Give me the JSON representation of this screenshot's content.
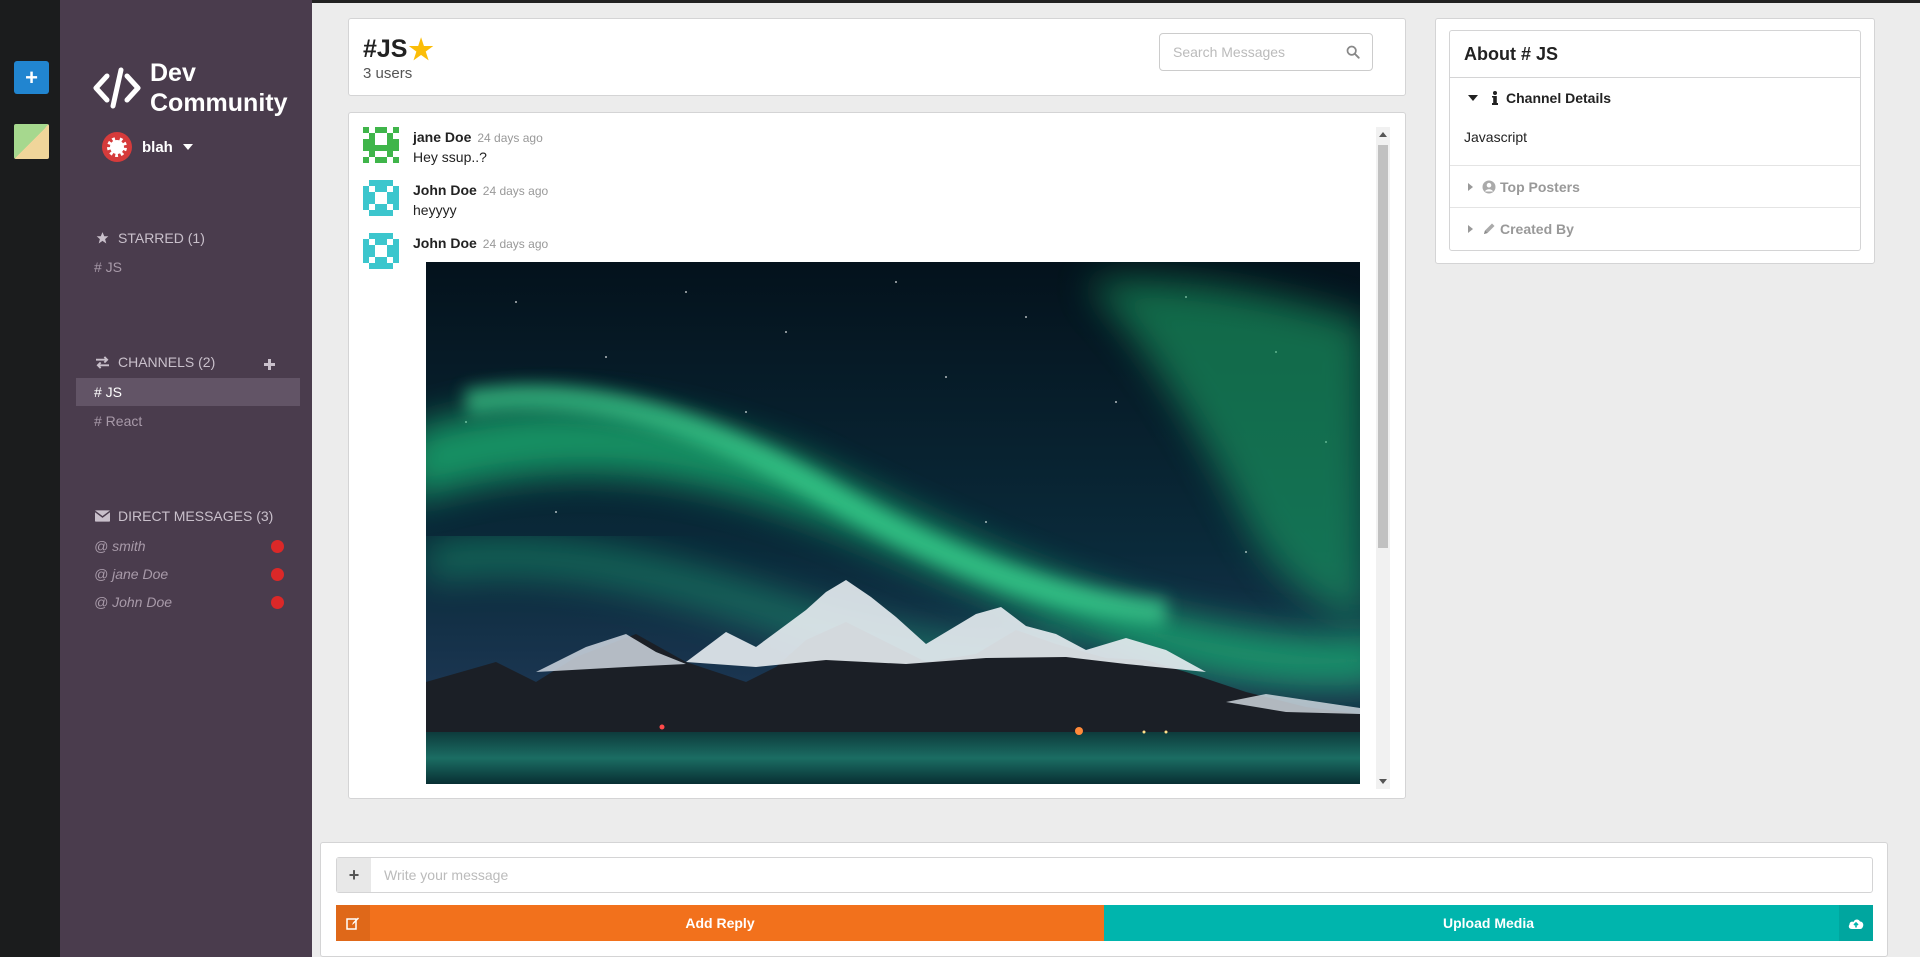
{
  "app": {
    "brand_line1": "Dev",
    "brand_line2": "Community",
    "user_name": "blah",
    "colors": {
      "rail_add": "#2185d0",
      "sidebar": "#4a3c4d",
      "reply": "#f2711c",
      "upload": "#00b5ad",
      "unread": "#db2828"
    }
  },
  "sidebar": {
    "starred": {
      "label": "STARRED (1)",
      "items": [
        "# JS"
      ]
    },
    "channels": {
      "label": "CHANNELS (2)",
      "items": [
        "# JS",
        "# React"
      ],
      "active": "# JS"
    },
    "direct_messages": {
      "label": "DIRECT MESSAGES (3)",
      "items": [
        "@ smith",
        "@ jane Doe",
        "@ John Doe"
      ]
    }
  },
  "header": {
    "title": "#JS",
    "users": "3 users",
    "search_placeholder": "Search Messages"
  },
  "messages": [
    {
      "author": "jane Doe",
      "time": "24 days ago",
      "text": "Hey ssup..?",
      "avatar": "green-identicon"
    },
    {
      "author": "John Doe",
      "time": "24 days ago",
      "text": "heyyyy",
      "avatar": "teal-identicon"
    },
    {
      "author": "John Doe",
      "time": "24 days ago",
      "text": "",
      "avatar": "teal-identicon",
      "attachment": "aurora-mountains-photo"
    }
  ],
  "about": {
    "title": "About # JS",
    "channel_details_label": "Channel Details",
    "channel_details_text": "Javascript",
    "top_posters_label": "Top Posters",
    "created_by_label": "Created By"
  },
  "form": {
    "message_placeholder": "Write your message",
    "reply_label": "Add Reply",
    "upload_label": "Upload Media"
  }
}
